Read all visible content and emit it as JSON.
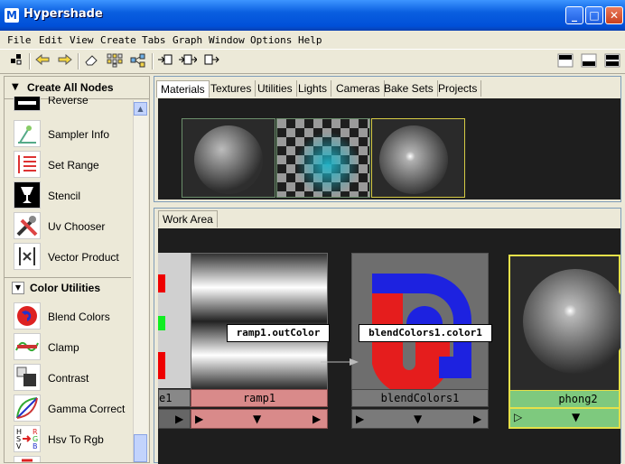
{
  "window": {
    "app_icon": "M",
    "title": "Hypershade",
    "buttons": {
      "minimize": "_",
      "maximize": "□",
      "close": "✕"
    }
  },
  "menubar": [
    "File",
    "Edit",
    "View",
    "Create",
    "Tabs",
    "Graph",
    "Window",
    "Options",
    "Help"
  ],
  "toolbar": {
    "icons": [
      "select-icon",
      "back-arrow-icon",
      "forward-arrow-icon",
      "eraser-icon",
      "grid-graph-icon",
      "graph-network-icon",
      "input-connections-icon",
      "input-output-connections-icon",
      "output-connections-icon",
      "layout-top-icon",
      "layout-bottom-icon",
      "layout-split-icon"
    ]
  },
  "left_panel": {
    "header": "Create All Nodes",
    "partial_item": "Reverse",
    "items_top": [
      "Sampler Info",
      "Set Range",
      "Stencil",
      "Uv Chooser",
      "Vector Product"
    ],
    "section": "Color Utilities",
    "items_color": [
      "Blend Colors",
      "Clamp",
      "Contrast",
      "Gamma Correct",
      "Hsv To Rgb"
    ]
  },
  "material_tabs": [
    "Materials",
    "Textures",
    "Utilities",
    "Lights",
    "Cameras",
    "Bake Sets",
    "Projects"
  ],
  "work_tab": "Work Area",
  "work_nodes": {
    "partial_left": "e1",
    "ramp": "ramp1",
    "blend": "blendColors1",
    "phong": "phong2"
  },
  "connection": {
    "from": "ramp1.outColor",
    "to": "blendColors1.color1"
  },
  "colors": {
    "title_bar": "#0a5fe0",
    "ramp_bar": "#d98a8a",
    "phong_bar": "#7ec97e",
    "blend_bar": "#7a7a7a",
    "phong_border": "#e5e14a"
  }
}
